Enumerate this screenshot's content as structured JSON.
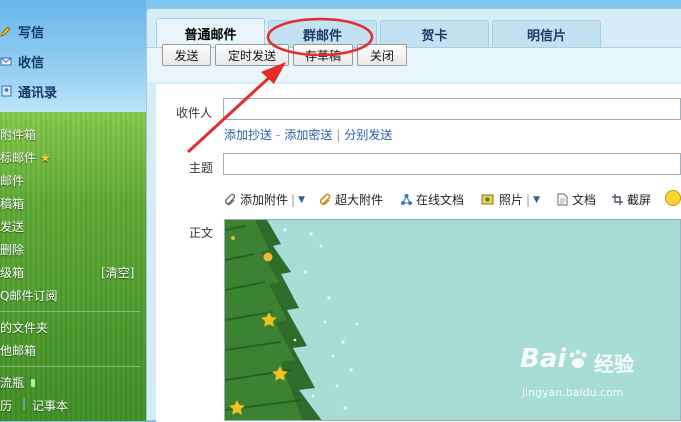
{
  "sidebar": {
    "main": [
      {
        "label": "写信",
        "icon": "pencil-icon"
      },
      {
        "label": "收信",
        "icon": "inbox-icon"
      },
      {
        "label": "通讯录",
        "icon": "contacts-icon"
      }
    ],
    "folders": [
      "附件箱",
      "标邮件",
      "邮件",
      "稿箱",
      "发送",
      "删除",
      "级箱",
      "Q邮件订阅",
      "的文件夹",
      "他邮箱",
      "流瓶",
      "历"
    ],
    "clear_label": "[清空]",
    "notes_label": "记事本"
  },
  "tabs": [
    "普通邮件",
    "群邮件",
    "贺卡",
    "明信片"
  ],
  "actions": [
    "发送",
    "定时发送",
    "存草稿",
    "关闭"
  ],
  "form": {
    "recipient_label": "收件人",
    "cc_link": "添加抄送",
    "bcc_link": "添加密送",
    "separate_link": "分别发送",
    "subject_label": "主题",
    "body_label": "正文"
  },
  "attach_tools": [
    {
      "label": "添加附件",
      "icon": "paperclip-icon"
    },
    {
      "label": "超大附件",
      "icon": "big-attachment-icon"
    },
    {
      "label": "在线文档",
      "icon": "online-doc-icon"
    },
    {
      "label": "照片",
      "icon": "photo-icon"
    },
    {
      "label": "文档",
      "icon": "document-icon"
    },
    {
      "label": "截屏",
      "icon": "screenshot-icon"
    }
  ],
  "watermark": {
    "brand": "Bai",
    "brand2": "经验",
    "url": "jingyan.baidu.com"
  },
  "colors": {
    "accent": "#2a5da8",
    "annotation": "#e52b2b",
    "tab_bg": "#c4e1f3"
  }
}
